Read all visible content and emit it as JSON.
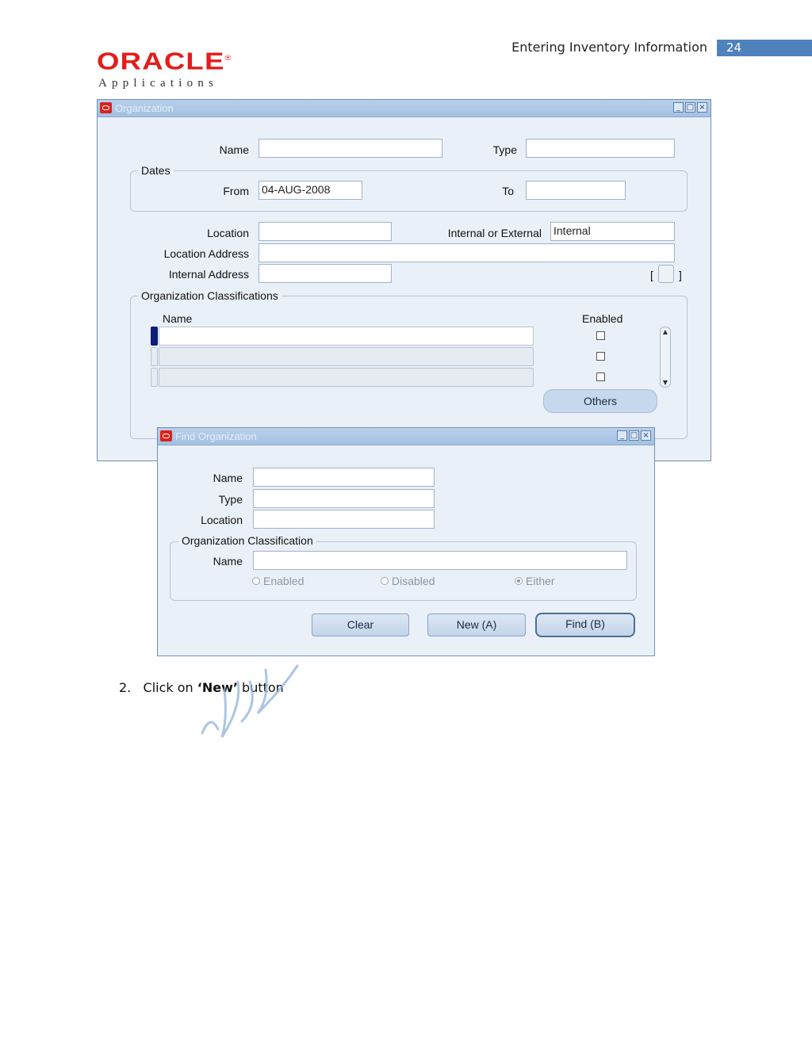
{
  "header": {
    "title": "Entering Inventory Information",
    "page_number": "24"
  },
  "logo": {
    "word": "ORACLE",
    "trademark": "®",
    "sub": "Applications"
  },
  "org_window": {
    "title": "Organization",
    "name_label": "Name",
    "name_value": "",
    "type_label": "Type",
    "type_value": "",
    "dates_legend": "Dates",
    "from_label": "From",
    "from_value": "04-AUG-2008",
    "to_label": "To",
    "to_value": "",
    "location_label": "Location",
    "location_value": "",
    "int_ext_label": "Internal or External",
    "int_ext_value": "Internal",
    "location_address_label": "Location Address",
    "location_address_value": "",
    "internal_address_label": "Internal Address",
    "internal_address_value": "",
    "desc_flex": {
      "open": "[",
      "close": "]"
    },
    "classifications_legend": "Organization Classifications",
    "col_name": "Name",
    "col_enabled": "Enabled",
    "others_button": "Others"
  },
  "find_window": {
    "title": "Find Organization",
    "name_label": "Name",
    "type_label": "Type",
    "location_label": "Location",
    "classification_legend": "Organization Classification",
    "class_name_label": "Name",
    "radio_enabled": "Enabled",
    "radio_disabled": "Disabled",
    "radio_either": "Either",
    "clear_button": "Clear",
    "new_button": "New (A)",
    "find_button": "Find (B)"
  },
  "instruction": {
    "number": "2.",
    "pre": "Click on ",
    "q_open": "‘",
    "emph": "New",
    "q_close": "’",
    "post": " button"
  },
  "icons": {
    "minimize": "minimize-icon",
    "maximize": "maximize-icon",
    "close": "close-icon",
    "oracle": "oracle-app-icon"
  },
  "colors": {
    "brand_red": "#e31d1a",
    "page_bar": "#4f81bd",
    "title_bar": "#a4c0e2"
  }
}
